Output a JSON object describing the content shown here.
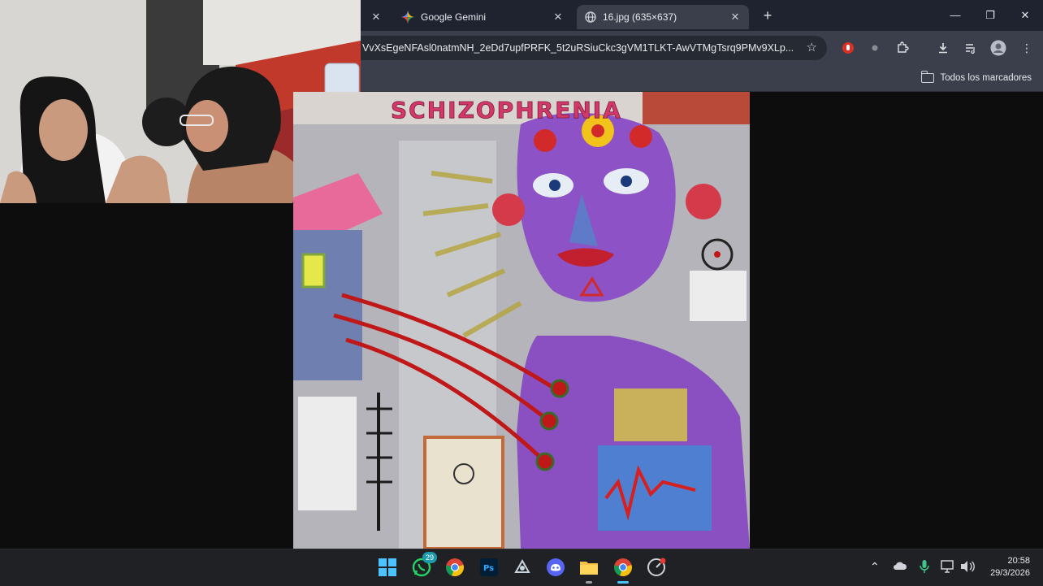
{
  "browser": {
    "tabs": [
      {
        "title": "Google Gemini"
      },
      {
        "title": "16.jpg (635×637)"
      }
    ],
    "url": "VvXsEgeNFAsl0natmNH_2eDd7upfPRFK_5t2uRSiuCkc3gVM1TLKT-AwVTMgTsrq9PMv9XLp...",
    "bookmarks_folder": "Todos los marcadores"
  },
  "painting": {
    "title_text": "SCHIZOPHRENIA"
  },
  "taskbar": {
    "whatsapp_badge": "29",
    "time": "20:58",
    "date": "29/3/2026"
  },
  "colors": {
    "tabstrip": "#1f2330",
    "toolbar": "#3a3f4b",
    "taskbar": "#202124",
    "purple_figure": "#8a4fc0"
  }
}
